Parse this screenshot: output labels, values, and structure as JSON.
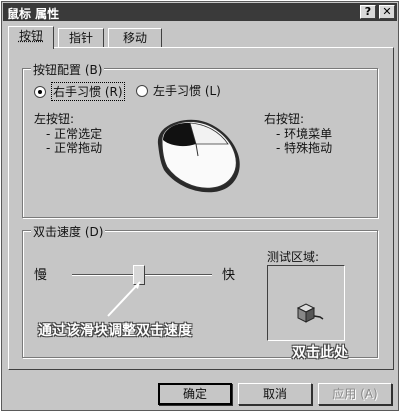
{
  "window": {
    "title": "鼠标 属性",
    "help_glyph": "?",
    "close_glyph": "✕"
  },
  "tabs": [
    {
      "label": "按钮",
      "active": true
    },
    {
      "label": "指针",
      "active": false
    },
    {
      "label": "移动",
      "active": false
    }
  ],
  "button_config": {
    "title": "按钮配置 (B)",
    "options": [
      {
        "label": "右手习惯 (R)",
        "checked": true
      },
      {
        "label": "左手习惯 (L)",
        "checked": false
      }
    ],
    "left_button": {
      "title": "左按钮:",
      "items": [
        "- 正常选定",
        "- 正常拖动"
      ]
    },
    "right_button": {
      "title": "右按钮:",
      "items": [
        "- 环境菜单",
        "- 特殊拖动"
      ]
    }
  },
  "double_click": {
    "title": "双击速度 (D)",
    "slow_label": "慢",
    "fast_label": "快",
    "slider_fraction": 0.48,
    "test_area_label": "测试区域:",
    "annotation_slider": "通过该滑块调整双击速度",
    "annotation_test": "双击此处"
  },
  "buttons": {
    "ok": "确定",
    "cancel": "取消",
    "apply": "应用 (A)"
  }
}
